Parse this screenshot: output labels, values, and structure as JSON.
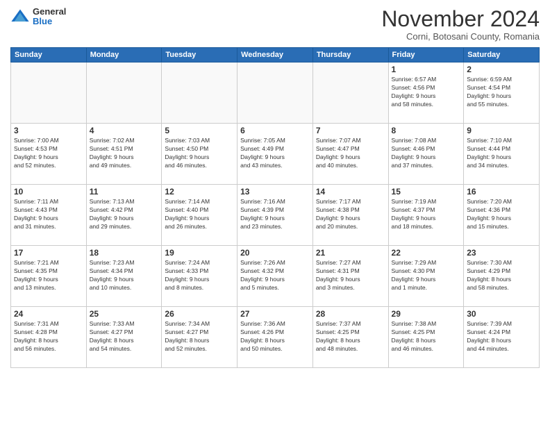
{
  "logo": {
    "general": "General",
    "blue": "Blue"
  },
  "title": "November 2024",
  "location": "Corni, Botosani County, Romania",
  "days_header": [
    "Sunday",
    "Monday",
    "Tuesday",
    "Wednesday",
    "Thursday",
    "Friday",
    "Saturday"
  ],
  "weeks": [
    [
      {
        "day": "",
        "info": ""
      },
      {
        "day": "",
        "info": ""
      },
      {
        "day": "",
        "info": ""
      },
      {
        "day": "",
        "info": ""
      },
      {
        "day": "",
        "info": ""
      },
      {
        "day": "1",
        "info": "Sunrise: 6:57 AM\nSunset: 4:56 PM\nDaylight: 9 hours\nand 58 minutes."
      },
      {
        "day": "2",
        "info": "Sunrise: 6:59 AM\nSunset: 4:54 PM\nDaylight: 9 hours\nand 55 minutes."
      }
    ],
    [
      {
        "day": "3",
        "info": "Sunrise: 7:00 AM\nSunset: 4:53 PM\nDaylight: 9 hours\nand 52 minutes."
      },
      {
        "day": "4",
        "info": "Sunrise: 7:02 AM\nSunset: 4:51 PM\nDaylight: 9 hours\nand 49 minutes."
      },
      {
        "day": "5",
        "info": "Sunrise: 7:03 AM\nSunset: 4:50 PM\nDaylight: 9 hours\nand 46 minutes."
      },
      {
        "day": "6",
        "info": "Sunrise: 7:05 AM\nSunset: 4:49 PM\nDaylight: 9 hours\nand 43 minutes."
      },
      {
        "day": "7",
        "info": "Sunrise: 7:07 AM\nSunset: 4:47 PM\nDaylight: 9 hours\nand 40 minutes."
      },
      {
        "day": "8",
        "info": "Sunrise: 7:08 AM\nSunset: 4:46 PM\nDaylight: 9 hours\nand 37 minutes."
      },
      {
        "day": "9",
        "info": "Sunrise: 7:10 AM\nSunset: 4:44 PM\nDaylight: 9 hours\nand 34 minutes."
      }
    ],
    [
      {
        "day": "10",
        "info": "Sunrise: 7:11 AM\nSunset: 4:43 PM\nDaylight: 9 hours\nand 31 minutes."
      },
      {
        "day": "11",
        "info": "Sunrise: 7:13 AM\nSunset: 4:42 PM\nDaylight: 9 hours\nand 29 minutes."
      },
      {
        "day": "12",
        "info": "Sunrise: 7:14 AM\nSunset: 4:40 PM\nDaylight: 9 hours\nand 26 minutes."
      },
      {
        "day": "13",
        "info": "Sunrise: 7:16 AM\nSunset: 4:39 PM\nDaylight: 9 hours\nand 23 minutes."
      },
      {
        "day": "14",
        "info": "Sunrise: 7:17 AM\nSunset: 4:38 PM\nDaylight: 9 hours\nand 20 minutes."
      },
      {
        "day": "15",
        "info": "Sunrise: 7:19 AM\nSunset: 4:37 PM\nDaylight: 9 hours\nand 18 minutes."
      },
      {
        "day": "16",
        "info": "Sunrise: 7:20 AM\nSunset: 4:36 PM\nDaylight: 9 hours\nand 15 minutes."
      }
    ],
    [
      {
        "day": "17",
        "info": "Sunrise: 7:21 AM\nSunset: 4:35 PM\nDaylight: 9 hours\nand 13 minutes."
      },
      {
        "day": "18",
        "info": "Sunrise: 7:23 AM\nSunset: 4:34 PM\nDaylight: 9 hours\nand 10 minutes."
      },
      {
        "day": "19",
        "info": "Sunrise: 7:24 AM\nSunset: 4:33 PM\nDaylight: 9 hours\nand 8 minutes."
      },
      {
        "day": "20",
        "info": "Sunrise: 7:26 AM\nSunset: 4:32 PM\nDaylight: 9 hours\nand 5 minutes."
      },
      {
        "day": "21",
        "info": "Sunrise: 7:27 AM\nSunset: 4:31 PM\nDaylight: 9 hours\nand 3 minutes."
      },
      {
        "day": "22",
        "info": "Sunrise: 7:29 AM\nSunset: 4:30 PM\nDaylight: 9 hours\nand 1 minute."
      },
      {
        "day": "23",
        "info": "Sunrise: 7:30 AM\nSunset: 4:29 PM\nDaylight: 8 hours\nand 58 minutes."
      }
    ],
    [
      {
        "day": "24",
        "info": "Sunrise: 7:31 AM\nSunset: 4:28 PM\nDaylight: 8 hours\nand 56 minutes."
      },
      {
        "day": "25",
        "info": "Sunrise: 7:33 AM\nSunset: 4:27 PM\nDaylight: 8 hours\nand 54 minutes."
      },
      {
        "day": "26",
        "info": "Sunrise: 7:34 AM\nSunset: 4:27 PM\nDaylight: 8 hours\nand 52 minutes."
      },
      {
        "day": "27",
        "info": "Sunrise: 7:36 AM\nSunset: 4:26 PM\nDaylight: 8 hours\nand 50 minutes."
      },
      {
        "day": "28",
        "info": "Sunrise: 7:37 AM\nSunset: 4:25 PM\nDaylight: 8 hours\nand 48 minutes."
      },
      {
        "day": "29",
        "info": "Sunrise: 7:38 AM\nSunset: 4:25 PM\nDaylight: 8 hours\nand 46 minutes."
      },
      {
        "day": "30",
        "info": "Sunrise: 7:39 AM\nSunset: 4:24 PM\nDaylight: 8 hours\nand 44 minutes."
      }
    ]
  ]
}
